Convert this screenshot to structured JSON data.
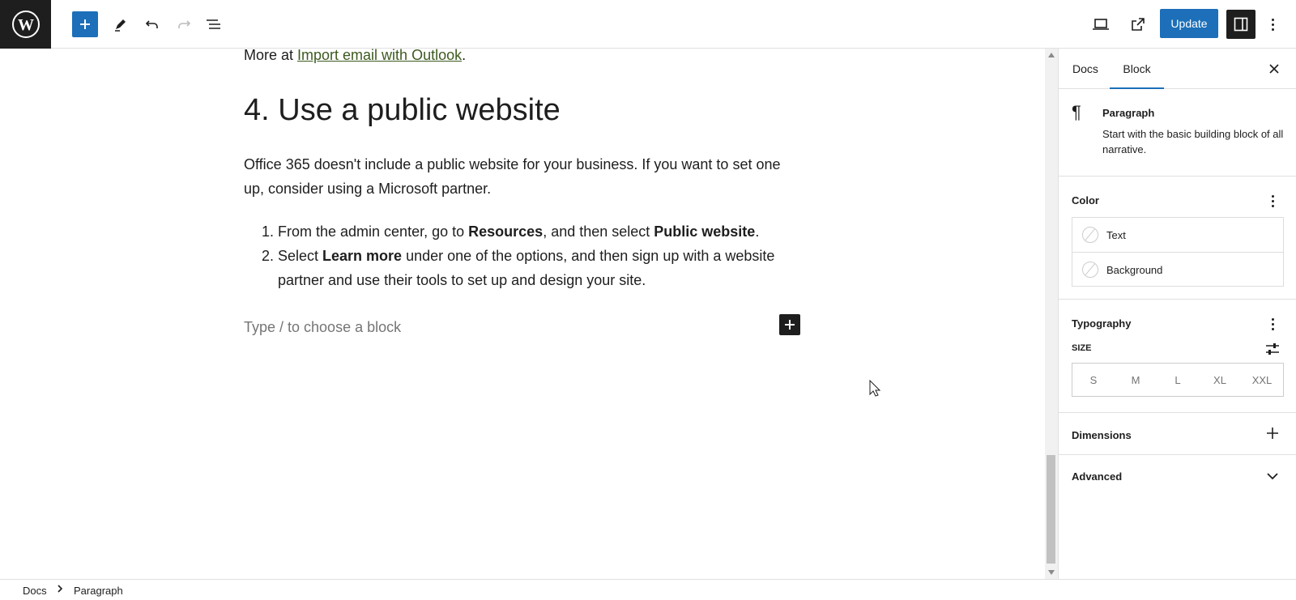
{
  "toolbar": {
    "logo_icon": "wordpress-logo-icon",
    "update_label": "Update",
    "accent_color": "#1c6fb8"
  },
  "editor": {
    "more_prefix": "More at ",
    "more_link": "Import email with Outlook",
    "more_suffix": ".",
    "heading": "4. Use a public website",
    "paragraph": "Office 365 doesn't include a public website for your business. If you want to set one up, consider using a Microsoft partner.",
    "list": [
      {
        "before": "From the admin center, go to ",
        "b1": "Resources",
        "mid": ", and then select ",
        "b2": "Public website",
        "after": "."
      },
      {
        "before": "Select ",
        "b1": "Learn more",
        "mid": " under one of the options, and then sign up with a website partner and use their tools to set up and design your site.",
        "b2": "",
        "after": ""
      }
    ],
    "placeholder": "Type / to choose a block"
  },
  "sidebar": {
    "tabs": [
      "Docs",
      "Block"
    ],
    "active_tab": "Block",
    "block": {
      "icon": "pilcrow-icon",
      "title": "Paragraph",
      "description": "Start with the basic building block of all narrative."
    },
    "color": {
      "title": "Color",
      "items": [
        "Text",
        "Background"
      ]
    },
    "typography": {
      "title": "Typography",
      "size_label": "SIZE",
      "sizes": [
        "S",
        "M",
        "L",
        "XL",
        "XXL"
      ]
    },
    "dimensions": {
      "title": "Dimensions"
    },
    "advanced": {
      "title": "Advanced"
    }
  },
  "breadcrumb": [
    "Docs",
    "Paragraph"
  ]
}
